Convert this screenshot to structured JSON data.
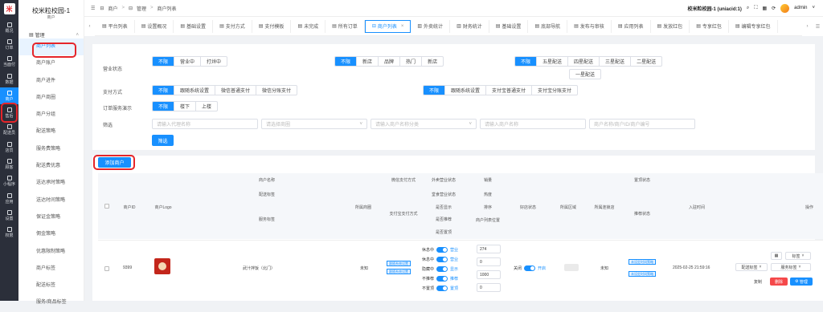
{
  "rail": {
    "items": [
      {
        "label": "概况",
        "icon": "overview-icon"
      },
      {
        "label": "订单",
        "icon": "order-icon"
      },
      {
        "label": "当面付",
        "icon": "pay-icon"
      },
      {
        "label": "数据",
        "icon": "data-icon"
      },
      {
        "label": "商户",
        "icon": "merchant-icon"
      },
      {
        "label": "售后",
        "icon": "aftersale-icon"
      },
      {
        "label": "配送员",
        "icon": "courier-icon"
      },
      {
        "label": "店员",
        "icon": "clerk-icon"
      },
      {
        "label": "顾客",
        "icon": "customer-icon"
      },
      {
        "label": "小程序",
        "icon": "miniprogram-icon"
      },
      {
        "label": "应用",
        "icon": "apps-icon"
      },
      {
        "label": "设置",
        "icon": "settings-icon"
      },
      {
        "label": "权限",
        "icon": "permission-icon"
      }
    ]
  },
  "sidebar": {
    "title": "校米粒校园-1",
    "subtitle": "商户",
    "group": "管理",
    "items": [
      "商户列表",
      "商户账户",
      "商户进件",
      "商户商圈",
      "商户分组",
      "配送策略",
      "服务费策略",
      "配送费优惠",
      "送达承时策略",
      "送达时间策略",
      "保证金策略",
      "佣金策略",
      "优惠限制策略",
      "商户标签",
      "配送标签",
      "服务/商品标签"
    ]
  },
  "header": {
    "crumbs": [
      "商户",
      "管理",
      "商户列表"
    ],
    "account": "校米粒校园-1 (uniacid:1)",
    "user": "admin"
  },
  "tabs": [
    "平台列表",
    "设置概况",
    "基础设置",
    "支付方式",
    "支付模板",
    "未完成",
    "所有订单",
    "商户列表",
    "外卖统计",
    "财务统计",
    "基础设置",
    "底部导航",
    "发布与审核",
    "应用列表",
    "发放红包",
    "专享红包",
    "编辑专享红包"
  ],
  "filters": {
    "status_label": "营业状态",
    "status": [
      "不限",
      "营业中",
      "打烊中"
    ],
    "type": [
      "不限",
      "新店",
      "品牌",
      "热门",
      "新店"
    ],
    "star": [
      "不限",
      "五星配送",
      "四星配送",
      "三星配送",
      "二星配送",
      "一星配送"
    ],
    "pay_label": "支付方式",
    "pay": [
      "不限",
      "跟随系统设置",
      "微信普通支付",
      "微信分账支付"
    ],
    "pay2": [
      "不限",
      "跟随系统设置",
      "支付宝普通支付",
      "支付宝分账支付"
    ],
    "service_label": "订单服务演示",
    "service": [
      "不限",
      "楼下",
      "上楼"
    ],
    "screen_label": "筛选",
    "inputs": [
      "请输入代理名称",
      "请选择商圈",
      "请输入商户名称分类",
      "请输入商户名称",
      "商户名称/商户ID/商户编号"
    ],
    "submit": "筛选"
  },
  "add_button": "添加商户",
  "table": {
    "headers": {
      "name": [
        "商户名称",
        "配送标签",
        "服务标签"
      ],
      "id": "商户ID",
      "logo": "商户Logo",
      "circle": "所属商圈",
      "pay": [
        "微信支付方式",
        "支付宝支付方式"
      ],
      "biz": [
        "外卖营业状态",
        "堂食营业状态",
        "是否显示",
        "是否推荐",
        "是否置顶"
      ],
      "sort": [
        "销量",
        "热度",
        "排序",
        "商户列表位置"
      ],
      "good": "好店状态",
      "area": "所属区域",
      "clerk": "所属连锁店",
      "top_status": [
        "置顶状态",
        "推荐状态"
      ],
      "join": "入驻时间",
      "op": "操作"
    },
    "row": {
      "id": "9399",
      "name": "武汁拌饭（北门）",
      "circle": "未知",
      "pay_tags": [
        "跟随系统设置",
        "跟随系统设置"
      ],
      "toggles": [
        {
          "off": "休息中",
          "on": "营业"
        },
        {
          "off": "休息中",
          "on": "营业"
        },
        {
          "off": "隐藏中",
          "on": "显示"
        },
        {
          "off": "不推荐",
          "on": "推荐"
        },
        {
          "off": "不置顶",
          "on": "置顶"
        }
      ],
      "nums": [
        "274",
        "0",
        "1000",
        "0"
      ],
      "good": {
        "off": "关闭",
        "on": "开启"
      },
      "clerk": "未知",
      "top_tags": [
        "未设定时间策略",
        "未设定时间策略"
      ],
      "join": "2025-02-25 21:59:16",
      "ops": {
        "tag": "标签",
        "delivery_tag": "配送标签",
        "service_tag": "服务标签",
        "copy": "复制",
        "delete": "删除",
        "manage": "管理"
      }
    }
  }
}
